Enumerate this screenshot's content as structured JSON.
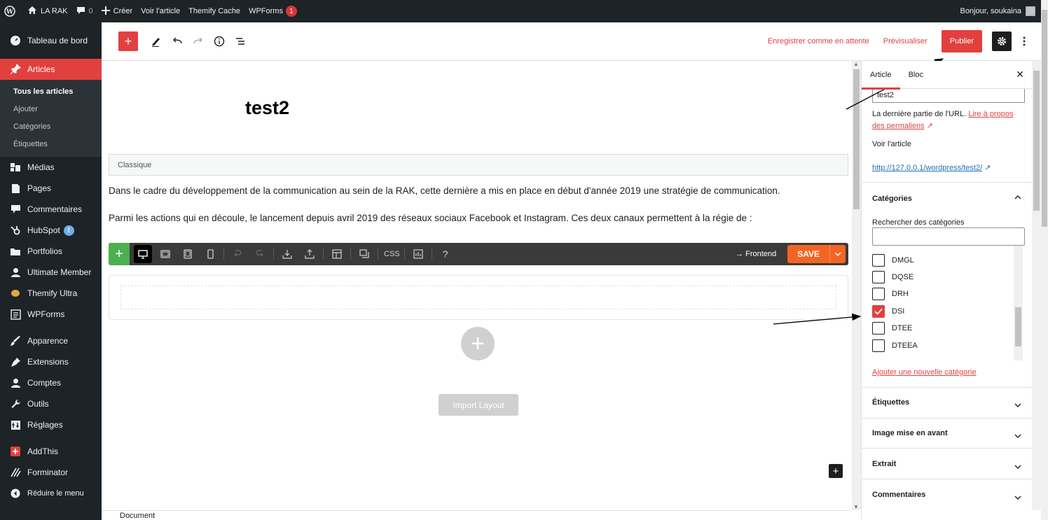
{
  "adminbar": {
    "site_name": "LA RAK",
    "comments_count": "0",
    "create_label": "Créer",
    "view_post": "Voir l'article",
    "themify_cache": "Themify Cache",
    "wpforms": "WPForms",
    "wpforms_badge": "1",
    "greeting": "Bonjour, soukaina"
  },
  "sidebar": {
    "dashboard": "Tableau de bord",
    "articles": "Articles",
    "submenu": [
      "Tous les articles",
      "Ajouter",
      "Catégories",
      "Étiquettes"
    ],
    "items": [
      "Médias",
      "Pages",
      "Commentaires",
      "HubSpot",
      "Portfolios",
      "Ultimate Member",
      "Themify Ultra",
      "WPForms",
      "Apparence",
      "Extensions",
      "Comptes",
      "Outils",
      "Réglages",
      "AddThis",
      "Forminator",
      "Réduire le menu"
    ],
    "hubspot_badge": "!"
  },
  "header": {
    "save_draft": "Enregistrer comme en attente",
    "preview": "Prévisualiser",
    "publish": "Publier"
  },
  "post": {
    "title": "test2",
    "classic_label": "Classique",
    "paragraph1": "Dans le cadre du développement de la communication au sein de la RAK, cette dernière a mis en place en début d'année 2019 une stratégie de communication.",
    "paragraph2": "Parmi les actions qui en découle, le lancement depuis avril 2019 des réseaux sociaux Facebook et Instagram. Ces deux canaux permettent à la régie de :"
  },
  "builder": {
    "css_label": "CSS",
    "frontend_label": "→ Frontend",
    "save_label": "SAVE",
    "import_layout": "Import Layout"
  },
  "footer": {
    "label": "Document"
  },
  "settings": {
    "tab_article": "Article",
    "tab_block": "Bloc",
    "slug_value": "test2",
    "url_help": "La dernière partie de l'URL.",
    "url_help_link": "Lire à propos des permaliens",
    "view_article": "Voir l'article",
    "permalink": "http://127.0.0.1/wordpress/test2/",
    "categories_title": "Catégories",
    "search_categories": "Rechercher des catégories",
    "categories": [
      {
        "name": "DMGL",
        "checked": false
      },
      {
        "name": "DQSE",
        "checked": false
      },
      {
        "name": "DRH",
        "checked": false
      },
      {
        "name": "DSI",
        "checked": true
      },
      {
        "name": "DTEE",
        "checked": false
      },
      {
        "name": "DTEEA",
        "checked": false
      }
    ],
    "add_category": "Ajouter une nouvelle catégorie",
    "panels": [
      "Étiquettes",
      "Image mise en avant",
      "Extrait",
      "Commentaires"
    ]
  },
  "colors": {
    "accent": "#e2403f",
    "admin_dark": "#1d2327",
    "builder_save": "#f26522"
  }
}
